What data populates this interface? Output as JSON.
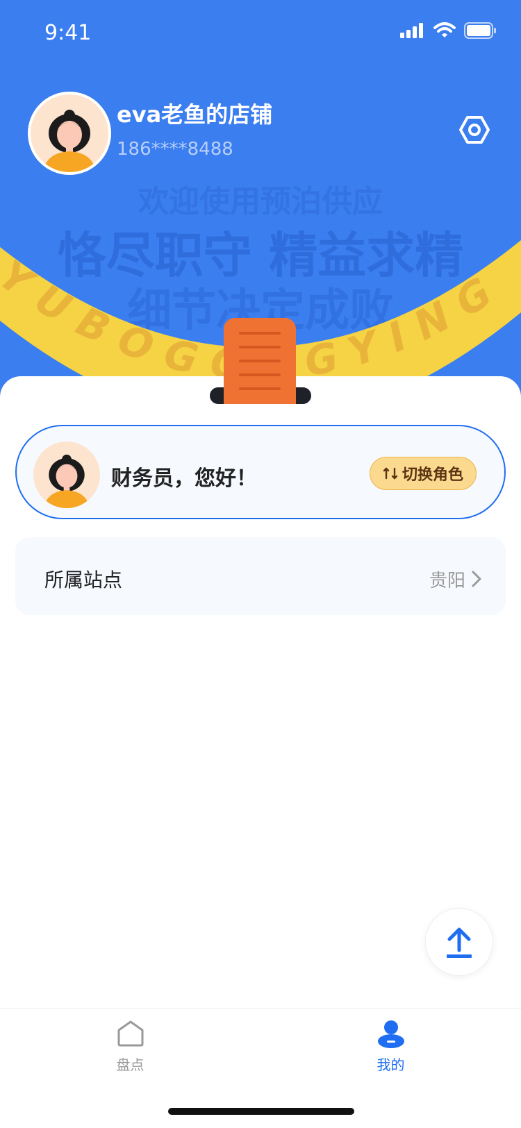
{
  "status_bar": {
    "time": "9:41"
  },
  "profile": {
    "shop_name": "eva老鱼的店铺",
    "phone": "186****8488"
  },
  "banner": {
    "line1": "欢迎使用预泊供应",
    "line2": "恪尽职守 精益求精",
    "line3": "细节决定成败",
    "ribbon_text": "YUBOGONGYING"
  },
  "role_card": {
    "greeting": "财务员，您好！",
    "switch_label": "切换角色"
  },
  "station": {
    "label": "所属站点",
    "value": "贵阳"
  },
  "tabs": [
    {
      "label": "盘点",
      "active": false
    },
    {
      "label": "我的",
      "active": true
    }
  ],
  "colors": {
    "primary": "#3b7ef0",
    "accent_blue": "#1f6ef2",
    "ribbon": "#f5d344",
    "tag": "#f07232",
    "switch_bg": "#fbd98f"
  }
}
